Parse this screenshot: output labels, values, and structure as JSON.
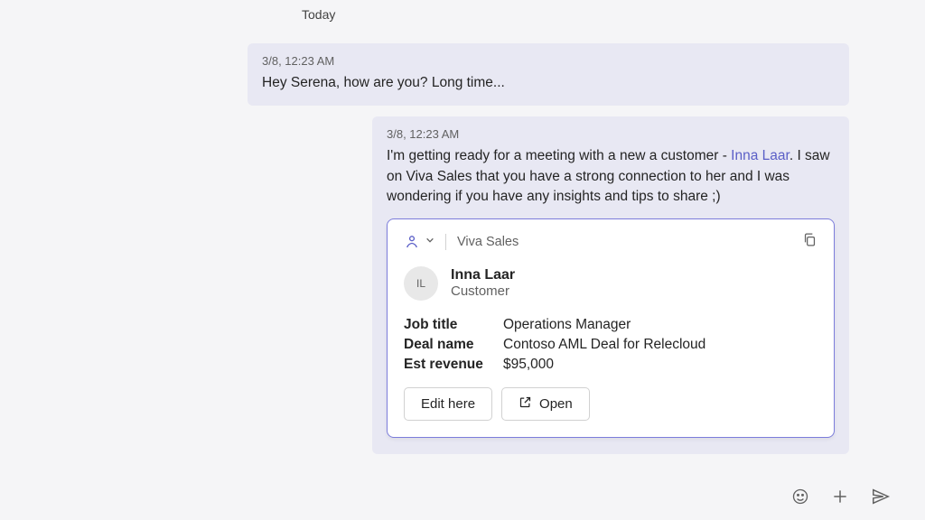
{
  "dateDivider": "Today",
  "messages": {
    "m1": {
      "timestamp": "3/8, 12:23 AM",
      "text": "Hey Serena, how are you? Long time..."
    },
    "m2": {
      "timestamp": "3/8, 12:23 AM",
      "textPre": "I'm getting ready for a meeting with a new a customer -  ",
      "mention": "Inna Laar",
      "textPost": ". I saw on Viva Sales that you have a strong connection to her and I was wondering if you have any insights and tips to share ;)"
    }
  },
  "card": {
    "appName": "Viva Sales",
    "contact": {
      "initials": "IL",
      "name": "Inna Laar",
      "role": "Customer"
    },
    "details": {
      "jobTitleLabel": "Job title",
      "jobTitleValue": "Operations Manager",
      "dealNameLabel": "Deal name",
      "dealNameValue": "Contoso AML Deal for Relecloud",
      "estRevenueLabel": "Est revenue",
      "estRevenueValue": "$95,000"
    },
    "actions": {
      "edit": "Edit here",
      "open": "Open"
    }
  }
}
